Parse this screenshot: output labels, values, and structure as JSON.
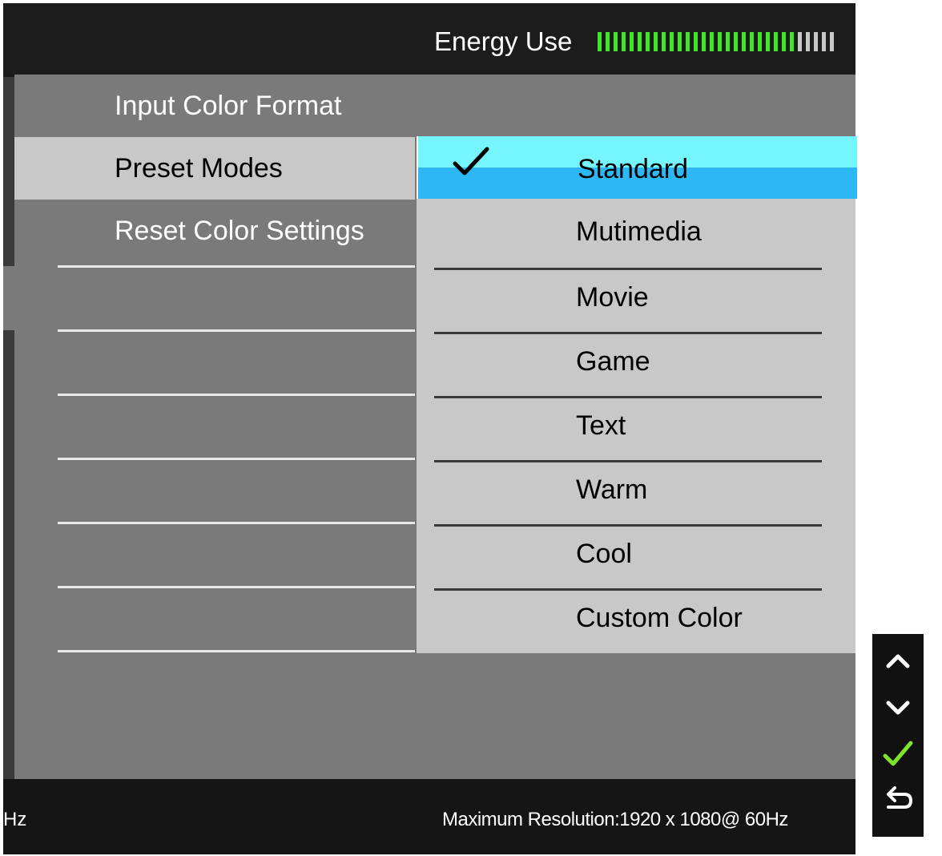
{
  "header": {
    "energy_label": "Energy Use",
    "energy_level_active": 0.83,
    "energy_active_color": "#3ee826",
    "energy_inactive_color": "#c8c8c8"
  },
  "menu": {
    "items": [
      {
        "label": "Input Color Format"
      },
      {
        "label": "Preset Modes",
        "selected": true
      },
      {
        "label": "Reset Color Settings"
      }
    ]
  },
  "submenu": {
    "options": [
      {
        "label": "Standard",
        "active": true
      },
      {
        "label": "Mutimedia"
      },
      {
        "label": "Movie"
      },
      {
        "label": "Game"
      },
      {
        "label": "Text"
      },
      {
        "label": "Warm"
      },
      {
        "label": "Cool"
      },
      {
        "label": "Custom Color"
      }
    ],
    "check_icon": "check-icon",
    "highlight_top_color": "#75f6ff",
    "highlight_bottom_color": "#2db8f5"
  },
  "footer": {
    "left_text": "Hz",
    "resolution_text": "Maximum Resolution:1920 x 1080@ 60Hz"
  },
  "nav_buttons": [
    {
      "icon": "chevron-up-icon"
    },
    {
      "icon": "chevron-down-icon"
    },
    {
      "icon": "check-icon",
      "color": "#7fe42a"
    },
    {
      "icon": "back-arrow-icon"
    }
  ]
}
